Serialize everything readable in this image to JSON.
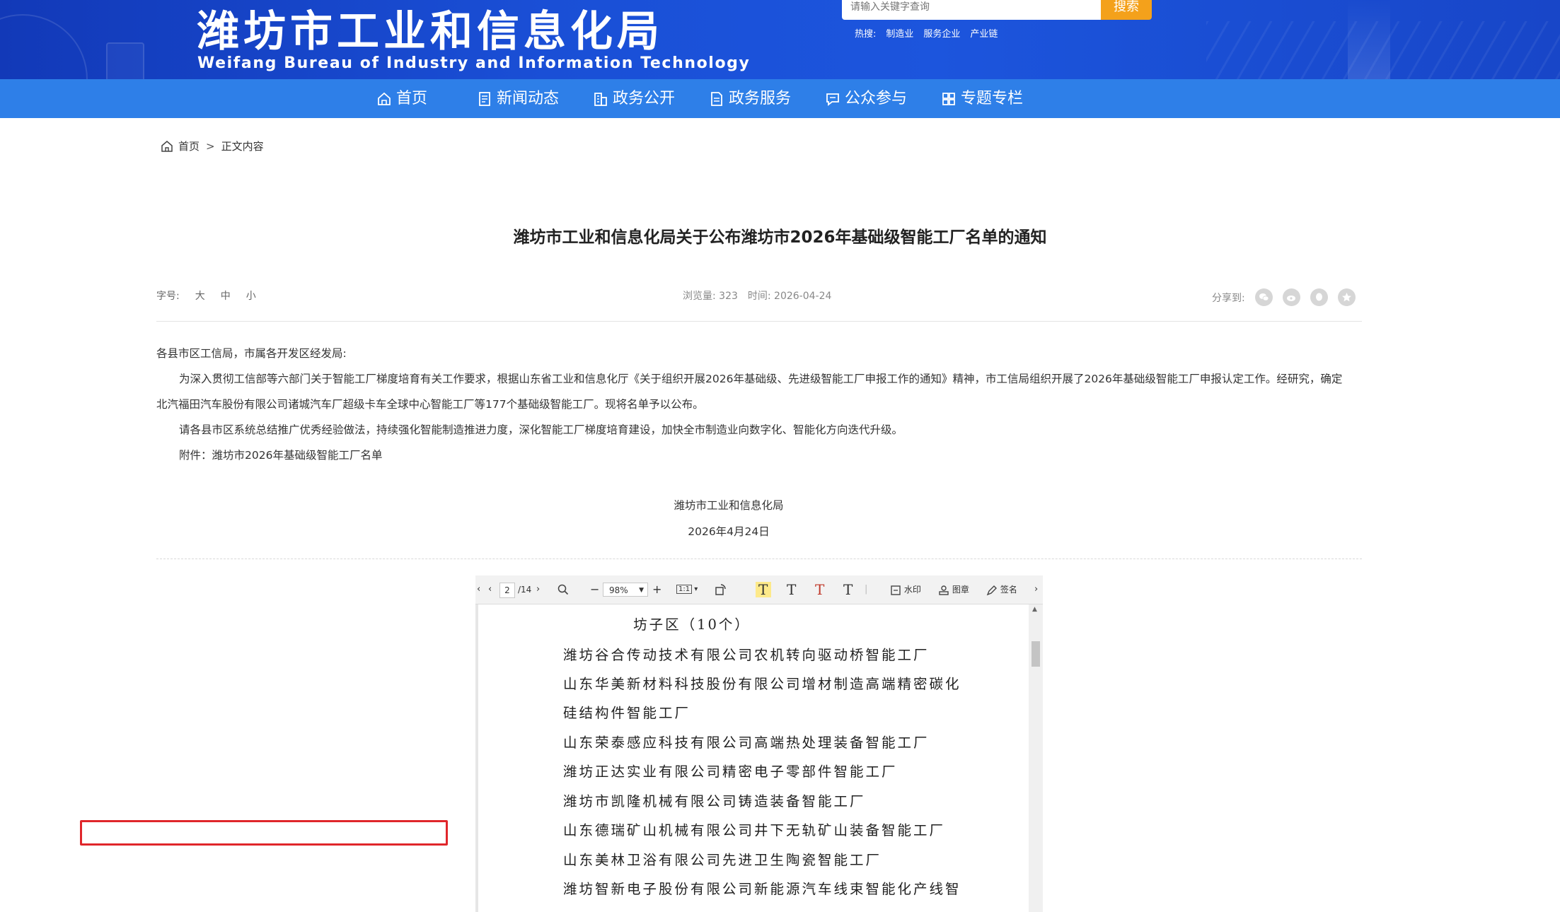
{
  "header": {
    "title": "潍坊市工业和信息化局",
    "subtitle": "Weifang Bureau of Industry and Information Technology",
    "search_placeholder": "请输入关键字查询",
    "search_button": "搜索",
    "hot_label": "热搜:",
    "hot_items": [
      "制造业",
      "服务企业",
      "产业链"
    ]
  },
  "nav": {
    "items": [
      {
        "label": "首页",
        "icon": "home-icon"
      },
      {
        "label": "新闻动态",
        "icon": "news-icon"
      },
      {
        "label": "政务公开",
        "icon": "building-icon"
      },
      {
        "label": "政务服务",
        "icon": "document-icon"
      },
      {
        "label": "公众参与",
        "icon": "chat-icon"
      },
      {
        "label": "专题专栏",
        "icon": "grid-icon"
      }
    ]
  },
  "breadcrumb": {
    "home": "首页",
    "sep": ">",
    "current": "正文内容"
  },
  "article": {
    "title": "潍坊市工业和信息化局关于公布潍坊市2026年基础级智能工厂名单的通知",
    "font_label": "字号:",
    "font_sizes": [
      "大",
      "中",
      "小"
    ],
    "views": "浏览量: 323",
    "time": "时间: 2026-04-24",
    "share_label": "分享到:",
    "share_icons": [
      "wechat-icon",
      "weibo-icon",
      "qq-icon",
      "qzone-icon"
    ],
    "salutation": "各县市区工信局，市属各开发区经发局:",
    "para1": "为深入贯彻工信部等六部门关于智能工厂梯度培育有关工作要求，根据山东省工业和信息化厅《关于组织开展2026年基础级、先进级智能工厂申报工作的通知》精神，市工信局组织开展了2026年基础级智能工厂申报认定工作。经研究，确定北汽福田汽车股份有限公司诸城汽车厂超级卡车全球中心智能工厂等177个基础级智能工厂。现将名单予以公布。",
    "para2": "请各县市区系统总结推广优秀经验做法，持续强化智能制造推进力度，深化智能工厂梯度培育建设，加快全市制造业向数字化、智能化方向迭代升级。",
    "attachment": "附件：潍坊市2026年基础级智能工厂名单",
    "signature": "潍坊市工业和信息化局",
    "date": "2026年4月24日"
  },
  "viewer": {
    "page_current": "2",
    "page_total": "/14",
    "zoom": "98%",
    "fit_label": "1:1",
    "watermark_label": "水印",
    "stamp_label": "图章",
    "sign_label": "签名",
    "doc_heading": "坊子区（10个）",
    "doc_lines": [
      "潍坊谷合传动技术有限公司农机转向驱动桥智能工厂",
      "山东华美新材料科技股份有限公司增材制造高端精密碳化",
      "硅结构件智能工厂",
      "山东荣泰感应科技有限公司高端热处理装备智能工厂",
      "潍坊正达实业有限公司精密电子零部件智能工厂",
      "潍坊市凯隆机械有限公司铸造装备智能工厂",
      "山东德瑞矿山机械有限公司井下无轨矿山装备智能工厂",
      "山东美林卫浴有限公司先进卫生陶瓷智能工厂",
      "潍坊智新电子股份有限公司新能源汽车线束智能化产线智"
    ],
    "highlight_color": "#e0262b"
  }
}
